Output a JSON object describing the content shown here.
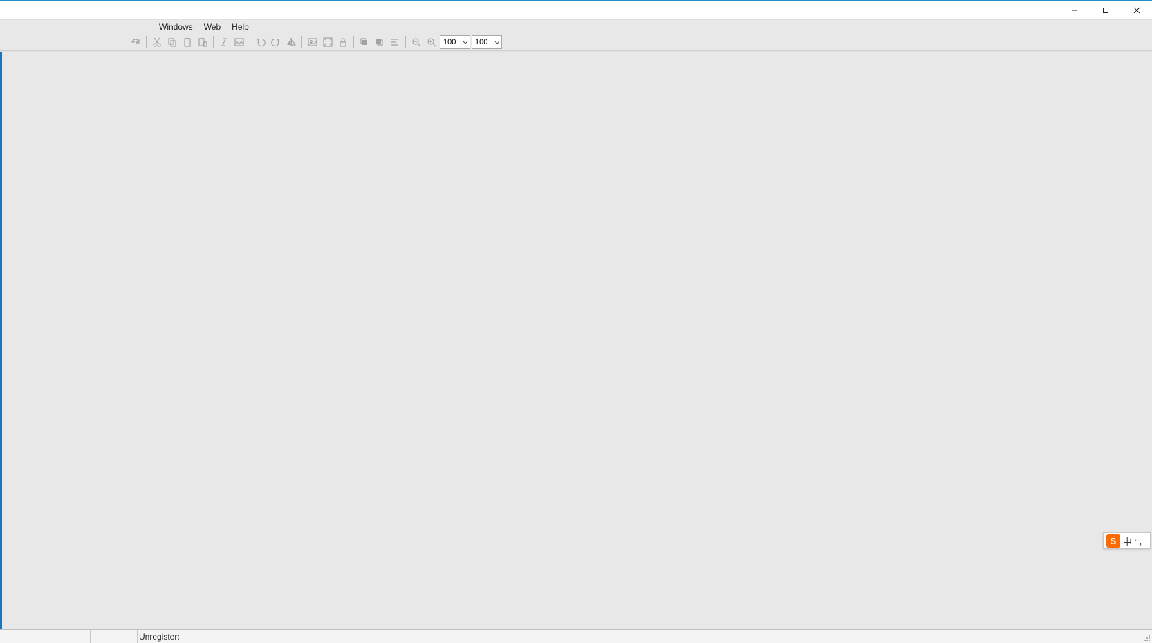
{
  "window_controls": {
    "minimize": "minimize",
    "maximize": "maximize",
    "close": "close"
  },
  "menubar": {
    "items": [
      {
        "label": "Windows"
      },
      {
        "label": "Web"
      },
      {
        "label": "Help"
      }
    ]
  },
  "toolbar": {
    "zoom1": "100",
    "zoom2": "100",
    "icons": {
      "redo": "redo",
      "cut": "cut",
      "copy": "copy",
      "paste": "paste",
      "paste_special": "paste-special",
      "italic": "italic",
      "picture": "picture",
      "rotate_ccw": "rotate-left",
      "rotate_cw": "rotate-right",
      "flip_horizontal": "flip-horizontal",
      "image": "image",
      "fit": "fit-window",
      "lock": "lock",
      "bring_front": "bring-front",
      "send_back": "send-back",
      "align": "align",
      "zoom_out": "zoom-out",
      "zoom_in": "zoom-in"
    }
  },
  "statusbar": {
    "text": "Unregistered"
  },
  "ime": {
    "logo_text": "S",
    "lang": "中",
    "punct": "°，"
  }
}
